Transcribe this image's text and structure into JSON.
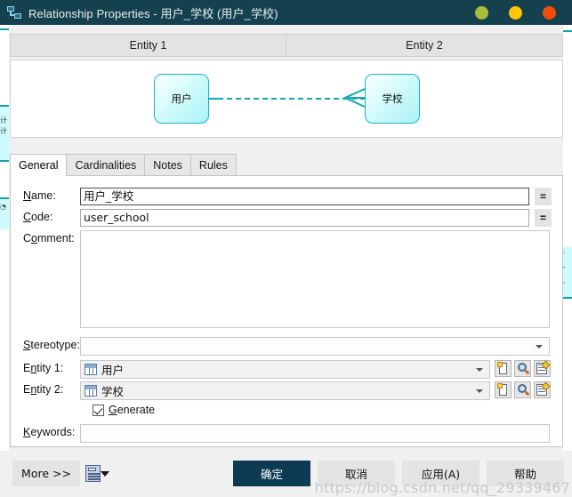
{
  "window": {
    "title": "Relationship Properties - 用户_学校 (用户_学校)",
    "icon": "relationship-icon",
    "controls": {
      "minimize": "minimize-button",
      "maximize": "maximize-button",
      "close": "close-button",
      "minimize_color": "#a6be3c",
      "maximize_color": "#fcc603",
      "close_color": "#f24d07"
    },
    "titlebar_color": "#15414f"
  },
  "preview": {
    "columns": [
      "Entity 1",
      "Entity 2"
    ],
    "entity1_label": "用户",
    "entity2_label": "学校",
    "link_style": "dashed",
    "link_color": "#13a6b4",
    "cardinality_marker": "crows-foot",
    "entity_border_color": "#18b5c4"
  },
  "tabs": [
    {
      "label": "General",
      "active": true
    },
    {
      "label": "Cardinalities",
      "active": false
    },
    {
      "label": "Notes",
      "active": false
    },
    {
      "label": "Rules",
      "active": false
    }
  ],
  "general": {
    "name": {
      "label": "Name:",
      "value": "用户_学校",
      "equals_button": "="
    },
    "code": {
      "label": "Code:",
      "value": "user_school",
      "equals_button": "="
    },
    "comment": {
      "label": "Comment:",
      "value": ""
    },
    "stereotype": {
      "label": "Stereotype:",
      "value": ""
    },
    "entity1": {
      "label": "Entity 1:",
      "value": "用户",
      "actions": [
        "create-icon",
        "browse-icon",
        "properties-icon"
      ]
    },
    "entity2": {
      "label": "Entity 2:",
      "value": "学校",
      "actions": [
        "create-icon",
        "browse-icon",
        "properties-icon"
      ]
    },
    "generate": {
      "label": "Generate",
      "checked": true
    },
    "keywords": {
      "label": "Keywords:",
      "value": ""
    }
  },
  "footer": {
    "more": "More >>",
    "report_icon": "report-icon",
    "report_caret": "dropdown-caret-icon",
    "ok": "确定",
    "cancel": "取消",
    "apply": "应用(A)",
    "help": "帮助",
    "primary_color": "#0d3b53"
  },
  "watermark": "https://blog.csdn.net/qq_29339467"
}
